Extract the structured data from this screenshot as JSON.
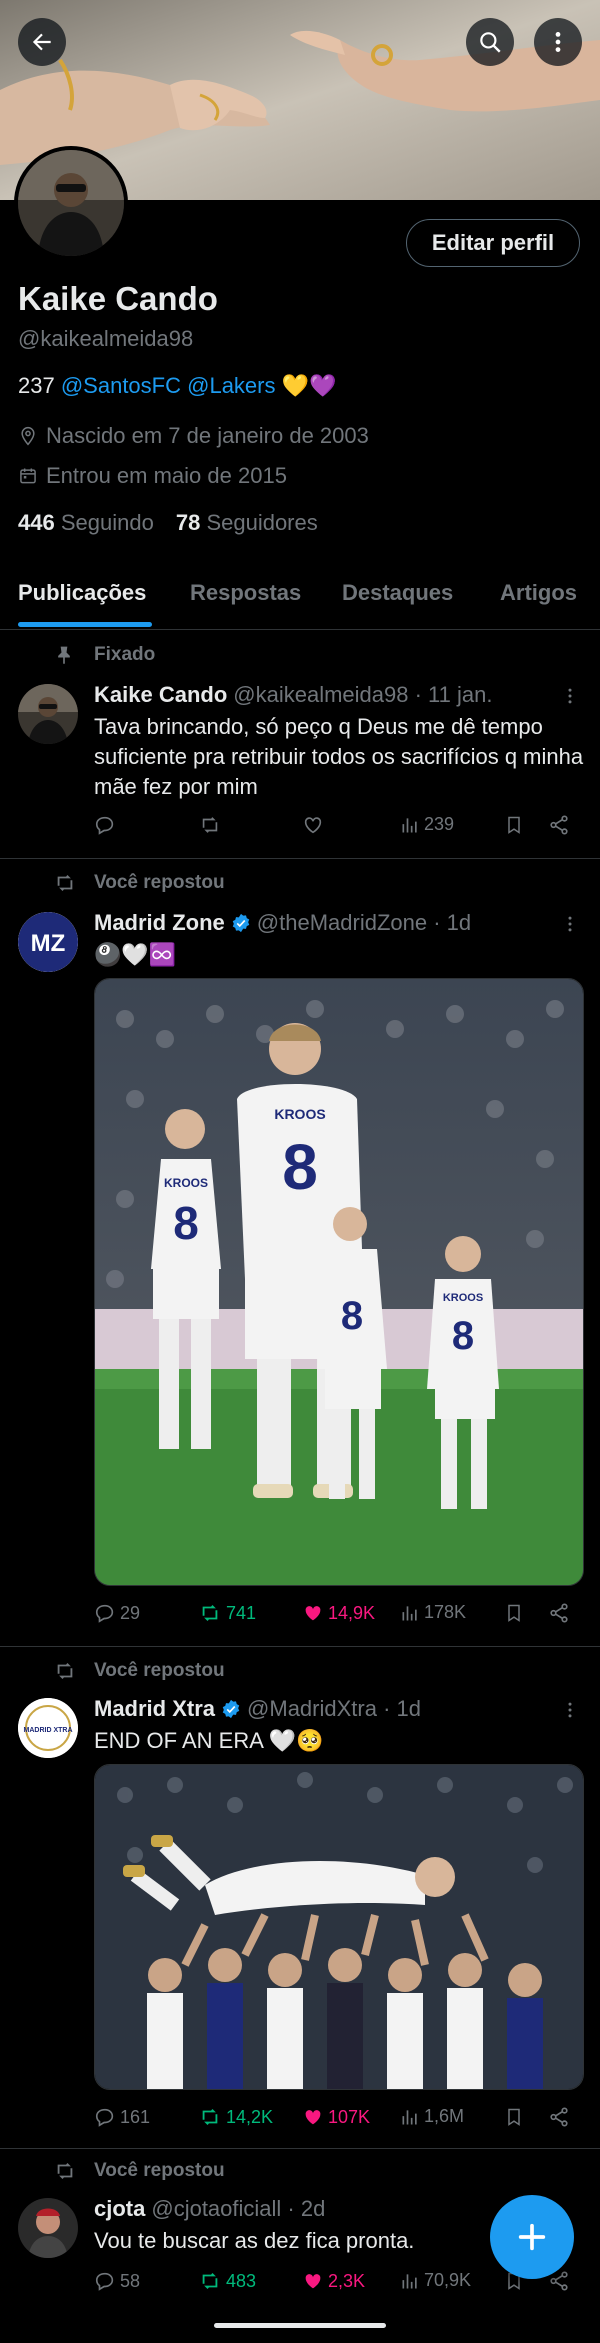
{
  "profile": {
    "name": "Kaike Cando",
    "handle": "@kaikealmeida98",
    "bio_prefix": "237",
    "bio_links": [
      "@SantosFC",
      "@Lakers"
    ],
    "bio_emoji": "💛💜",
    "birth": "Nascido em 7 de janeiro de 2003",
    "joined": "Entrou em maio de 2015",
    "following_count": "446",
    "following_label": "Seguindo",
    "followers_count": "78",
    "followers_label": "Seguidores",
    "edit_label": "Editar perfil"
  },
  "tabs": [
    "Publicações",
    "Respostas",
    "Destaques",
    "Artigos"
  ],
  "pinned": {
    "label": "Fixado",
    "name": "Kaike Cando",
    "meta": "@kaikealmeida98 · 11 jan.",
    "text": "Tava brincando, só peço q Deus me dê tempo suficiente pra retribuir todos os sacrifícios q minha mãe fez por mim",
    "views": "239"
  },
  "posts": [
    {
      "social": "Você repostou",
      "name": "Madrid Zone",
      "meta": "@theMadridZone · 1d",
      "text": "🎱🤍♾️",
      "avatar_text": "MZ",
      "replies": "29",
      "reposts": "741",
      "likes": "14,9K",
      "views": "178K",
      "image_caption": "KROOS"
    },
    {
      "social": "Você repostou",
      "name": "Madrid Xtra",
      "meta": "@MadridXtra · 1d",
      "text": "END OF AN ERA 🤍🥺",
      "avatar_text": "MADRID XTRA",
      "replies": "161",
      "reposts": "14,2K",
      "likes": "107K",
      "views": "1,6M"
    },
    {
      "social": "Você repostou",
      "name": "cjota",
      "meta": "@cjotaoficiall · 2d",
      "text": "Vou te buscar as dez fica pronta.",
      "replies": "58",
      "reposts": "483",
      "likes": "2,3K",
      "views": "70,9K"
    }
  ],
  "colors": {
    "accent": "#1d9bf0",
    "muted": "#71767b",
    "repost": "#00ba7c",
    "like": "#f91880",
    "bg": "#000000"
  }
}
